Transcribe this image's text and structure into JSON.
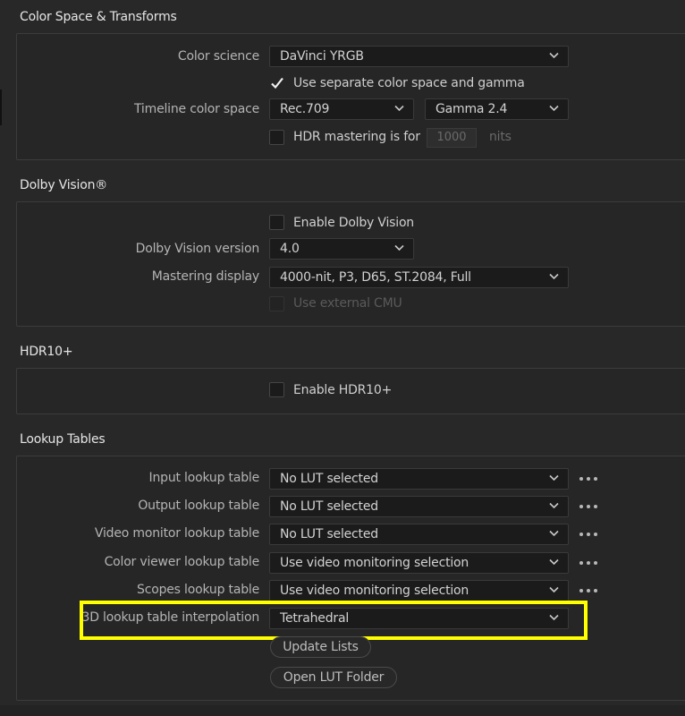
{
  "color_space": {
    "title": "Color Space & Transforms",
    "color_science_label": "Color science",
    "color_science_value": "DaVinci YRGB",
    "separate_gamma_label": "Use separate color space and gamma",
    "separate_gamma_checked": true,
    "timeline_label": "Timeline color space",
    "timeline_space_value": "Rec.709",
    "timeline_gamma_value": "Gamma 2.4",
    "hdr_label": "HDR mastering is for",
    "hdr_value": "1000",
    "hdr_unit": "nits"
  },
  "dolby": {
    "title": "Dolby Vision®",
    "enable_label": "Enable Dolby Vision",
    "version_label": "Dolby Vision version",
    "version_value": "4.0",
    "mastering_label": "Mastering display",
    "mastering_value": "4000-nit, P3, D65, ST.2084, Full",
    "cmu_label": "Use external CMU"
  },
  "hdr10": {
    "title": "HDR10+",
    "enable_label": "Enable HDR10+"
  },
  "lut": {
    "title": "Lookup Tables",
    "rows": [
      {
        "label": "Input lookup table",
        "value": "No LUT selected"
      },
      {
        "label": "Output lookup table",
        "value": "No LUT selected"
      },
      {
        "label": "Video monitor lookup table",
        "value": "No LUT selected"
      },
      {
        "label": "Color viewer lookup table",
        "value": "Use video monitoring selection"
      },
      {
        "label": "Scopes lookup table",
        "value": "Use video monitoring selection"
      }
    ],
    "interp_label": "3D lookup table interpolation",
    "interp_value": "Tetrahedral",
    "update_button": "Update Lists",
    "open_folder_button": "Open LUT Folder"
  },
  "colors": {
    "highlight": "#ffff00",
    "background": "#282828",
    "field": "#1b1b1b"
  },
  "icons": {
    "dropdown": "chevron-down-icon",
    "checkmark": "checkmark-icon",
    "more": "more-options-icon"
  }
}
